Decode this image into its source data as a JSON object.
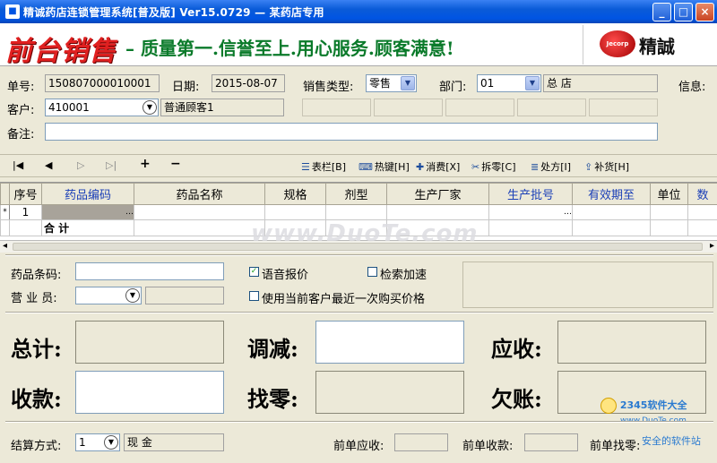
{
  "window": {
    "title": "精诚药店连锁管理系统[普及版] Ver15.0729 — 某药店专用",
    "minimize": "_",
    "maximize": "□",
    "close": "×"
  },
  "banner": {
    "brand": "前台销售",
    "slogan": "– 质量第一.信誉至上.用心服务.顾客满意!",
    "logo_mark": "Jecorp",
    "logo_text": "精誠"
  },
  "form": {
    "order_no_label": "单号:",
    "order_no": "150807000010001",
    "date_label": "日期:",
    "date": "2015-08-07",
    "sale_type_label": "销售类型:",
    "sale_type": "零售",
    "dept_label": "部门:",
    "dept_code": "01",
    "dept_name": "总 店",
    "info_label": "信息:",
    "customer_label": "客户:",
    "customer_code": "410001",
    "customer_name": "普通顾客1",
    "remark_label": "备注:",
    "remark": ""
  },
  "toolbar": {
    "first": "|◀",
    "prev": "◀",
    "next": "▷",
    "last": "▷|",
    "add": "+",
    "remove": "−",
    "buttons": [
      {
        "icon": "☰",
        "label": "表栏[B]"
      },
      {
        "icon": "⌨",
        "label": "热键[H]"
      },
      {
        "icon": "✚",
        "label": "消费[X]"
      },
      {
        "icon": "✂",
        "label": "拆零[C]"
      },
      {
        "icon": "≣",
        "label": "处方[I]"
      },
      {
        "icon": "⇪",
        "label": "补货[H]"
      }
    ]
  },
  "grid": {
    "columns": [
      "序号",
      "药品编码",
      "药品名称",
      "规格",
      "剂型",
      "生产厂家",
      "生产批号",
      "有效期至",
      "单位",
      "数"
    ],
    "rows": [
      {
        "marker": "*",
        "index": "1",
        "code_btn": "…",
        "batch_btn": "…"
      }
    ],
    "total_label": "合 计"
  },
  "detail": {
    "barcode_label": "药品条码:",
    "barcode": "",
    "clerk_label": "营 业 员:",
    "clerk": "",
    "voice_label": "语音报价",
    "voice_checked": true,
    "search_label": "检索加速",
    "search_checked": false,
    "lastprice_label": "使用当前客户最近一次购买价格",
    "lastprice_checked": false
  },
  "totals": {
    "total_label": "总计:",
    "adjust_label": "调减:",
    "receivable_label": "应收:",
    "received_label": "收款:",
    "change_label": "找零:",
    "debt_label": "欠账:"
  },
  "footer": {
    "settle_label": "结算方式:",
    "settle_code": "1",
    "settle_name": "现  金",
    "prev_receivable_label": "前单应收:",
    "prev_received_label": "前单收款:",
    "prev_change_label": "前单找零:"
  },
  "watermarks": {
    "center": "www.DuoTe.com",
    "corner": "2345软件大全",
    "corner_url": "www.DuoTe.com",
    "corner_sub": "安全的软件站"
  }
}
